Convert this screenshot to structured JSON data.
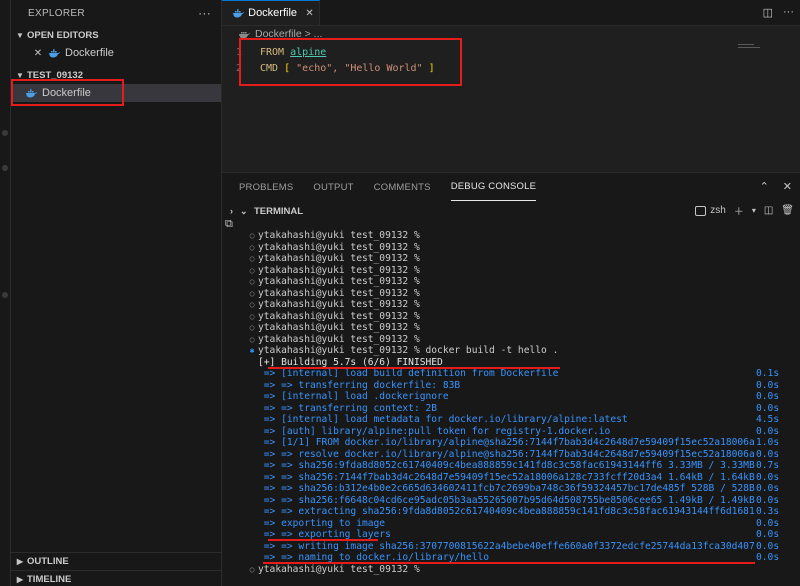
{
  "sidebar": {
    "title": "EXPLORER",
    "more_icon": "ellipsis-icon",
    "open_editors_label": "OPEN EDITORS",
    "open_editors": [
      {
        "label": "Dockerfile"
      }
    ],
    "folder_label": "TEST_09132",
    "files": [
      {
        "label": "Dockerfile"
      }
    ],
    "outline_label": "OUTLINE",
    "timeline_label": "TIMELINE"
  },
  "editor": {
    "tab_label": "Dockerfile",
    "breadcrumb_file": "Dockerfile",
    "breadcrumb_rest": "> ...",
    "lines": [
      {
        "num": "1",
        "kw": "FROM",
        "rest": "alpine"
      },
      {
        "num": "2",
        "kw": "CMD",
        "open": "[",
        "args": "\"echo\", \"Hello World\"",
        "close": "]"
      }
    ]
  },
  "panel": {
    "tabs": [
      "PROBLEMS",
      "OUTPUT",
      "COMMENTS",
      "DEBUG CONSOLE"
    ],
    "active_tab": "DEBUG CONSOLE",
    "terminal_label": "TERMINAL",
    "shell": "zsh",
    "lines": [
      {
        "mark": "circle",
        "text": "ytakahashi@yuki test_09132 %",
        "time": "",
        "style": "p"
      },
      {
        "mark": "circle",
        "text": "ytakahashi@yuki test_09132 %",
        "time": "",
        "style": "p"
      },
      {
        "mark": "circle",
        "text": "ytakahashi@yuki test_09132 %",
        "time": "",
        "style": "p"
      },
      {
        "mark": "circle",
        "text": "ytakahashi@yuki test_09132 %",
        "time": "",
        "style": "p"
      },
      {
        "mark": "circle",
        "text": "ytakahashi@yuki test_09132 %",
        "time": "",
        "style": "p"
      },
      {
        "mark": "circle",
        "text": "ytakahashi@yuki test_09132 %",
        "time": "",
        "style": "p"
      },
      {
        "mark": "circle",
        "text": "ytakahashi@yuki test_09132 %",
        "time": "",
        "style": "p"
      },
      {
        "mark": "circle",
        "text": "ytakahashi@yuki test_09132 %",
        "time": "",
        "style": "p"
      },
      {
        "mark": "circle",
        "text": "ytakahashi@yuki test_09132 %",
        "time": "",
        "style": "p"
      },
      {
        "mark": "circle",
        "text": "ytakahashi@yuki test_09132 %",
        "time": "",
        "style": "p"
      },
      {
        "mark": "star",
        "text": "ytakahashi@yuki test_09132 % docker build -t hello .",
        "time": "",
        "style": "p"
      },
      {
        "mark": "",
        "text": "[+] Building 5.7s (6/6) FINISHED",
        "time": "",
        "style": "wht"
      },
      {
        "mark": "",
        "text": " => [internal] load build definition from Dockerfile",
        "time": "0.1s",
        "style": "c"
      },
      {
        "mark": "",
        "text": " => => transferring dockerfile: 83B",
        "time": "0.0s",
        "style": "c"
      },
      {
        "mark": "",
        "text": " => [internal] load .dockerignore",
        "time": "0.0s",
        "style": "c"
      },
      {
        "mark": "",
        "text": " => => transferring context: 2B",
        "time": "0.0s",
        "style": "c"
      },
      {
        "mark": "",
        "text": " => [internal] load metadata for docker.io/library/alpine:latest",
        "time": "4.5s",
        "style": "c"
      },
      {
        "mark": "",
        "text": " => [auth] library/alpine:pull token for registry-1.docker.io",
        "time": "0.0s",
        "style": "c"
      },
      {
        "mark": "",
        "text": " => [1/1] FROM docker.io/library/alpine@sha256:7144f7bab3d4c2648d7e59409f15ec52a18006a",
        "time": "1.0s",
        "style": "c"
      },
      {
        "mark": "",
        "text": " => => resolve docker.io/library/alpine@sha256:7144f7bab3d4c2648d7e59409f15ec52a18006a",
        "time": "0.0s",
        "style": "c"
      },
      {
        "mark": "",
        "text": " => => sha256:9fda8d8052c61740409c4bea888859c141fd8c3c58fac61943144ff6 3.33MB / 3.33MB",
        "time": "0.7s",
        "style": "c"
      },
      {
        "mark": "",
        "text": " => => sha256:7144f7bab3d4c2648d7e59409f15ec52a18006a128c733fcff20d3a4 1.64kB / 1.64kB",
        "time": "0.0s",
        "style": "c"
      },
      {
        "mark": "",
        "text": " => => sha256:b312e4b0e2c665d634602411fcb7c2699ba748c36f59324457bc17de485f 528B / 528B",
        "time": "0.0s",
        "style": "c"
      },
      {
        "mark": "",
        "text": " => => sha256:f6648c04cd6ce95adc05b3aa55265007b95d64d508755be8506cee65 1.49kB / 1.49kB",
        "time": "0.0s",
        "style": "c"
      },
      {
        "mark": "",
        "text": " => => extracting sha256:9fda8d8052c61740409c4bea888859c141fd8c3c58fac61943144ff6d1681",
        "time": "0.3s",
        "style": "c"
      },
      {
        "mark": "",
        "text": " => exporting to image",
        "time": "0.0s",
        "style": "c"
      },
      {
        "mark": "",
        "text": " => => exporting layers",
        "time": "0.0s",
        "style": "c"
      },
      {
        "mark": "",
        "text": " => => writing image sha256:3707700815622a4bebe40effe660a0f3372edcfe25744da13fca30d407",
        "time": "0.0s",
        "style": "c"
      },
      {
        "mark": "",
        "text": " => => naming to docker.io/library/hello",
        "time": "0.0s",
        "style": "c"
      },
      {
        "mark": "circle",
        "text": "ytakahashi@yuki test_09132 %",
        "time": "",
        "style": "p"
      }
    ]
  },
  "colors": {
    "annotation": "#e51c1c",
    "terminal_blue": "#3794ff",
    "accent": "#0078d4"
  }
}
